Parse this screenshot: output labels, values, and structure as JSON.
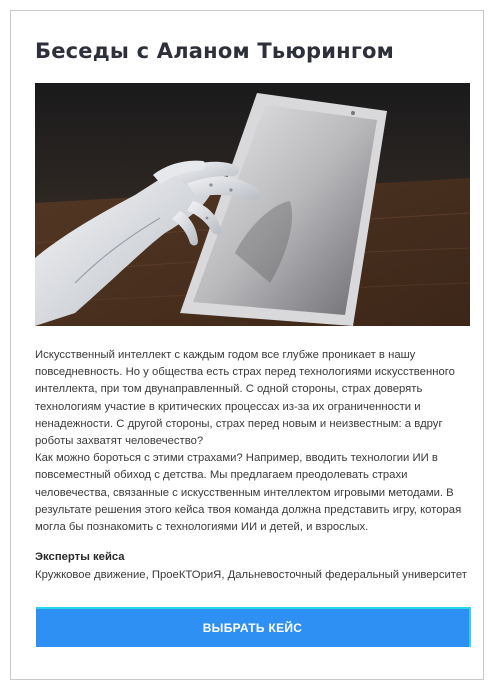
{
  "card": {
    "title": "Беседы с Аланом Тьюрингом",
    "image_subject": "robot-hand-touching-tablet",
    "description": [
      "Искусственный интеллект с каждым годом все глубже проникает в нашу повседневность. Но у общества есть страх перед технологиями искусственного интеллекта, при том двунаправленный. С одной стороны, страх доверять технологиям участие в критических процессах из-за их ограниченности и ненадежности. С другой стороны, страх перед новым и неизвестным: а вдруг роботы захватят человечество?",
      "Как можно бороться с этими страхами? Например, вводить технологии ИИ в повсеместный обиход с детства. Мы предлагаем преодолевать страхи человечества, связанные с искусственным интеллектом игровыми методами. В результате решения этого кейса твоя команда должна представить игру, которая могла бы познакомить с технологиями ИИ и детей, и взрослых."
    ],
    "experts_heading": "Эксперты кейса",
    "experts_text": "Кружковое движение, ПроеКТОриЯ, Дальневосточный федеральный университет",
    "cta_label": "ВЫБРАТЬ КЕЙС"
  },
  "colors": {
    "accent": "#2e90f2",
    "accent_border": "#27d6e8",
    "title": "#2d2f3a",
    "text": "#3a3a3a"
  }
}
